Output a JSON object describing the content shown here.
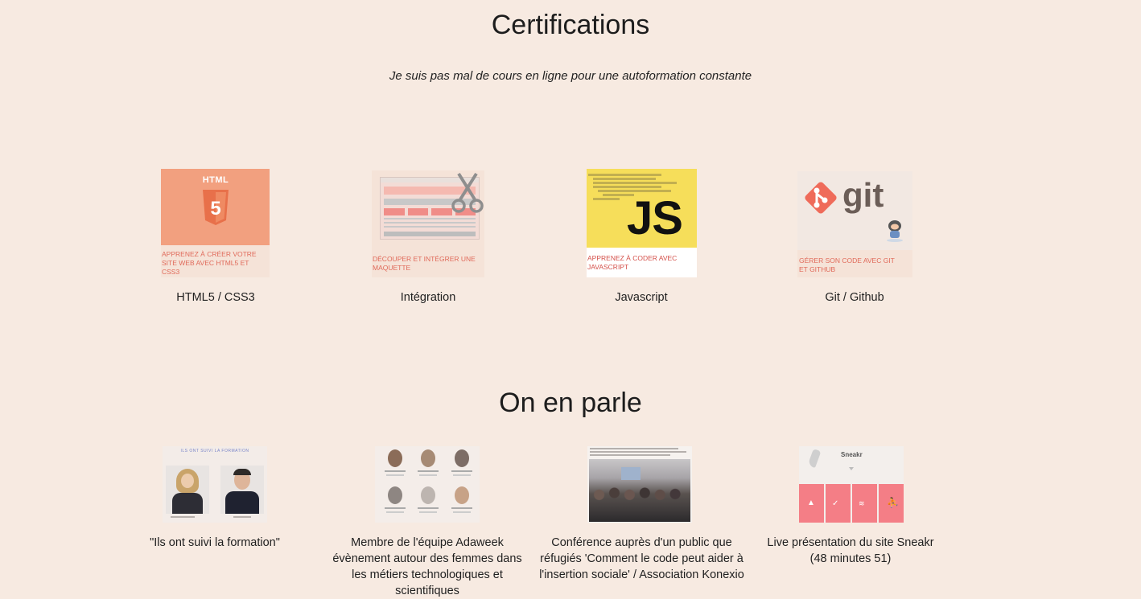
{
  "certifications": {
    "title": "Certifications",
    "subtitle": "Je suis pas mal de cours en ligne pour une autoformation constante",
    "items": [
      {
        "caption": "HTML5 / CSS3",
        "thumb_title": "HTML",
        "thumb_text": "Apprenez à créer votre site web avec HTML5 et CSS3",
        "icon": "html5-icon"
      },
      {
        "caption": "Intégration",
        "thumb_text": "Découper et intégrer une maquette",
        "icon": "scissors-icon"
      },
      {
        "caption": "Javascript",
        "thumb_title": "JS",
        "thumb_text": "Apprenez à coder avec JavaScript",
        "icon": "javascript-icon"
      },
      {
        "caption": "Git / Github",
        "thumb_title": "git",
        "thumb_text": "Gérer son code avec Git et GitHub",
        "icon": "git-icon"
      }
    ]
  },
  "press": {
    "title": "On en parle",
    "items": [
      {
        "caption": "\"Ils ont suivi la formation\"",
        "thumb_title": "ILS ONT SUIVI LA FORMATION"
      },
      {
        "caption": "Membre de l'équipe Adaweek évènement autour des femmes dans les métiers technologiques et scientifiques"
      },
      {
        "caption": "Conférence auprès d'un public que réfugiés 'Comment le code peut aider à l'insertion sociale' / Association Konexio"
      },
      {
        "caption": "Live présentation du site Sneakr (48 minutes 51)",
        "thumb_title": "Sneakr"
      }
    ]
  },
  "colors": {
    "background": "#f7eae1",
    "html_orange": "#f2a07f",
    "js_yellow": "#f6de5a",
    "git_red": "#ef6b5a",
    "sneakr_pink": "#f47e86"
  }
}
